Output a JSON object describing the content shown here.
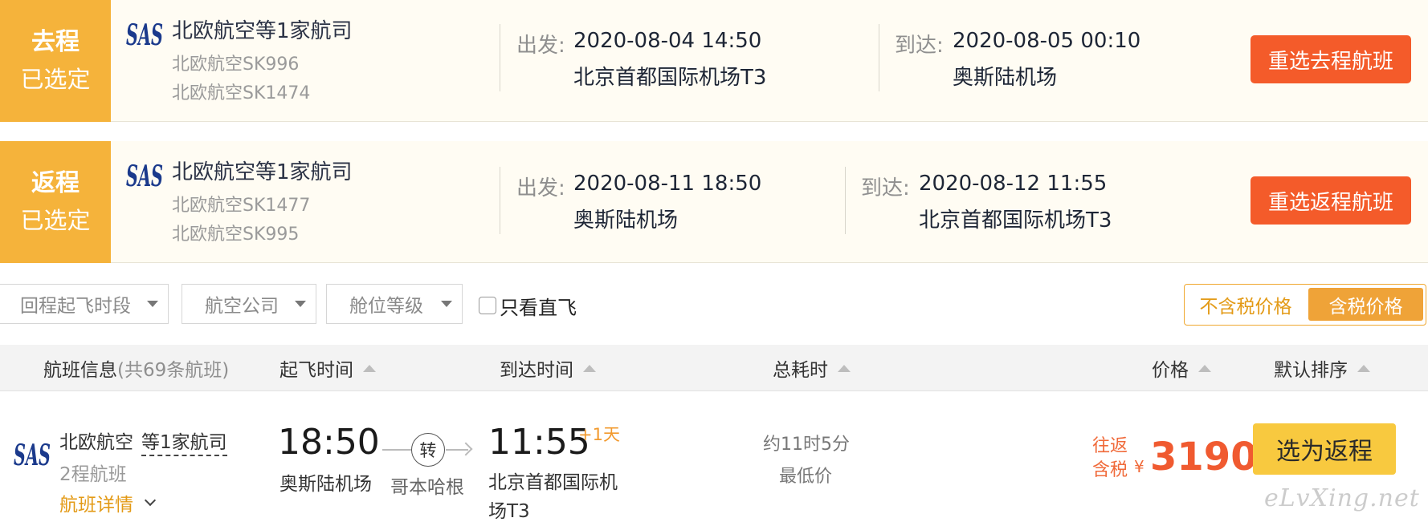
{
  "outbound": {
    "badge_line1": "去程",
    "badge_line2": "已选定",
    "airline": "北欧航空等1家航司",
    "flight1": "北欧航空SK996",
    "flight2": "北欧航空SK1474",
    "depart_label": "出发:",
    "depart_datetime": "2020-08-04 14:50",
    "depart_airport": "北京首都国际机场T3",
    "arrive_label": "到达:",
    "arrive_datetime": "2020-08-05 00:10",
    "arrive_airport": "奥斯陆机场",
    "reselect": "重选去程航班"
  },
  "return": {
    "badge_line1": "返程",
    "badge_line2": "已选定",
    "airline": "北欧航空等1家航司",
    "flight1": "北欧航空SK1477",
    "flight2": "北欧航空SK995",
    "depart_label": "出发:",
    "depart_datetime": "2020-08-11 18:50",
    "depart_airport": "奥斯陆机场",
    "arrive_label": "到达:",
    "arrive_datetime": "2020-08-12 11:55",
    "arrive_airport": "北京首都国际机场T3",
    "reselect": "重选返程航班"
  },
  "filters": {
    "time_slot": "回程起飞时段",
    "airline": "航空公司",
    "cabin": "舱位等级",
    "direct_only": "只看直飞",
    "direct_checked": false,
    "price_excl_tax": "不含税价格",
    "price_incl_tax": "含税价格",
    "active_price_mode": "含税价格"
  },
  "sort_header": {
    "flight_info": "航班信息",
    "flight_count": "(共69条航班)",
    "depart_time": "起飞时间",
    "arrive_time": "到达时间",
    "duration": "总耗时",
    "price": "价格",
    "default_sort": "默认排序"
  },
  "result": {
    "airline": "北欧航空",
    "airline_extra": "等1家航司",
    "legs": "2程航班",
    "details": "航班详情",
    "depart_time": "18:50",
    "depart_airport": "奥斯陆机场",
    "transfer": "转",
    "via": "哥本哈根",
    "arrive_time": "11:55",
    "day_offset": "+1天",
    "arrive_airport": "北京首都国际机场T3",
    "duration": "约11时5分",
    "lowest": "最低价",
    "price_label1": "往返",
    "price_label2": "含税",
    "currency": "¥",
    "price": "3190",
    "choose": "选为返程"
  },
  "logo_text": "SAS",
  "watermark": "eLvXing.net",
  "colors": {
    "badge": "#f5b33b",
    "reselect": "#f45b2a",
    "price": "#f05a30",
    "choose": "#f8c93f",
    "accent": "#efa338"
  }
}
